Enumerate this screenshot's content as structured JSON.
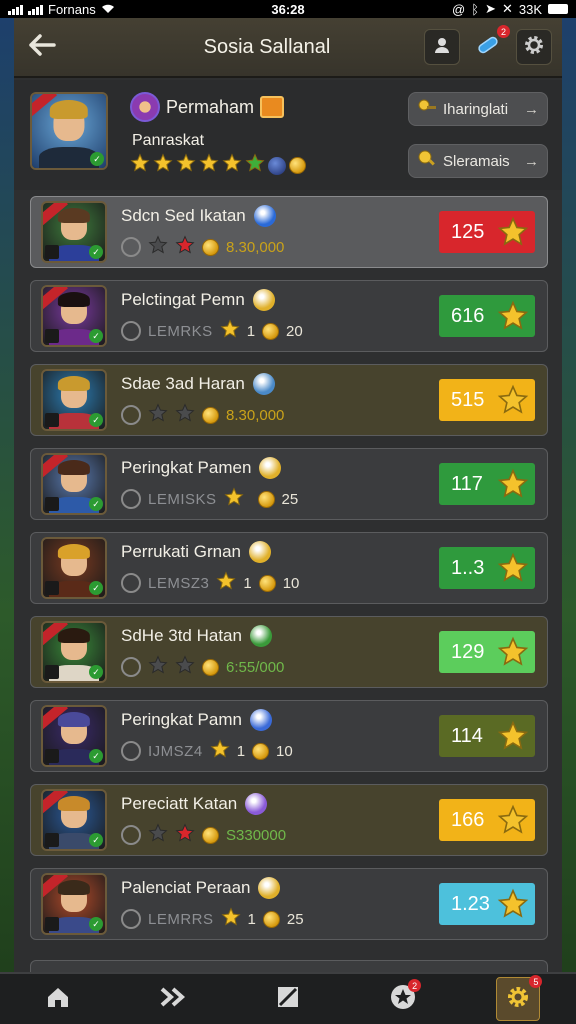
{
  "status_bar": {
    "carrier": "Fornans",
    "time": "36:28",
    "battery": "33K"
  },
  "header": {
    "title": "Sosia Sallanal",
    "notification_count": "2"
  },
  "profile": {
    "name": "Permaham",
    "subtitle": "Panraskat",
    "stars": 6,
    "buttons": [
      {
        "label": "Iharinglati",
        "arrow": "→"
      },
      {
        "label": "Sleramais",
        "arrow": "→"
      }
    ]
  },
  "rows": [
    {
      "name": "Sdcn Sed Ikatan",
      "meta_label": "",
      "meta_value": "",
      "points": "8.30,000",
      "score": "125",
      "score_color": "#d8262c",
      "style": "sel",
      "avatar": {
        "bg": "#3f7d3d",
        "hair": "#5a3a22",
        "body": "#2c3f9a",
        "ribbon": true
      }
    },
    {
      "name": "Pelctingat Pemn",
      "meta_label": "LEMRKS",
      "meta_value": "1",
      "points": "20",
      "score": "616",
      "score_color": "#2f9a3d",
      "style": "gray",
      "avatar": {
        "bg": "#7a3aa0",
        "hair": "#1a1010",
        "body": "#6c2a8a",
        "ribbon": true
      }
    },
    {
      "name": "Sdae 3ad Haran",
      "meta_label": "",
      "meta_value": "",
      "points": "8.30,000",
      "score": "515",
      "score_color": "#f2b318",
      "style": "olive",
      "avatar": {
        "bg": "#2c7fb7",
        "hair": "#c99a2e",
        "body": "#b8323a",
        "ribbon": false
      }
    },
    {
      "name": "Peringkat Pamen",
      "meta_label": "LEMISKS",
      "meta_value": "",
      "points": "25",
      "score": "117",
      "score_color": "#2f9a3d",
      "style": "gray",
      "avatar": {
        "bg": "#5a7ab0",
        "hair": "#4a2a1a",
        "body": "#2d5aa8",
        "ribbon": true
      }
    },
    {
      "name": "Perrukati Grnan",
      "meta_label": "LEMSZ3",
      "meta_value": "1",
      "points": "10",
      "score": "1..3",
      "score_color": "#2f9a3d",
      "style": "gray",
      "avatar": {
        "bg": "#7a3a20",
        "hair": "#d9a12a",
        "body": "#5a2a18",
        "ribbon": false
      }
    },
    {
      "name": "SdHe 3td Hatan",
      "meta_label": "",
      "meta_value": "",
      "points": "6:55/000",
      "score": "129",
      "score_color": "#5ccd5c",
      "style": "olive",
      "avatar": {
        "bg": "#3a8a3a",
        "hair": "#2a1a10",
        "body": "#ded6c6",
        "ribbon": true
      }
    },
    {
      "name": "Peringkat Pamn",
      "meta_label": "IJMSZ4",
      "meta_value": "1",
      "points": "10",
      "score": "114",
      "score_color": "#5a6a24",
      "style": "gray",
      "avatar": {
        "bg": "#3a2a6a",
        "hair": "#4a4a9a",
        "body": "#2a2a5a",
        "ribbon": true
      }
    },
    {
      "name": "Pereciatt Katan",
      "meta_label": "",
      "meta_value": "",
      "points": "S330000",
      "score": "166",
      "score_color": "#f2b318",
      "style": "olive",
      "avatar": {
        "bg": "#2a5a9a",
        "hair": "#c88a2a",
        "body": "#3a4a6a",
        "ribbon": true
      }
    },
    {
      "name": "Palenciat Peraan",
      "meta_label": "LEMRRS",
      "meta_value": "1",
      "points": "25",
      "score": "1.23",
      "score_color": "#4dc1dc",
      "style": "gray",
      "avatar": {
        "bg": "#b04a2a",
        "hair": "#3a2a1a",
        "body": "#3a4a8a",
        "ribbon": true
      }
    }
  ],
  "bottom_nav": [
    {
      "name": "home",
      "badge": ""
    },
    {
      "name": "forward",
      "badge": ""
    },
    {
      "name": "edit",
      "badge": ""
    },
    {
      "name": "missions",
      "badge": "2"
    },
    {
      "name": "settings",
      "badge": "5"
    }
  ]
}
